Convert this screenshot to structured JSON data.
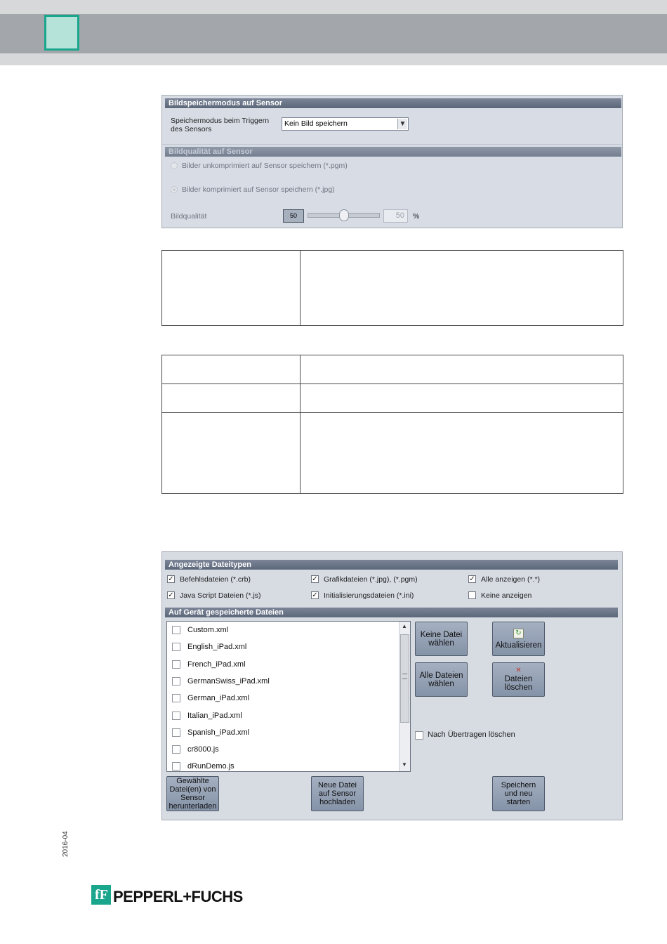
{
  "header": {
    "accent_color": "#1aa68c"
  },
  "image_storage_panel": {
    "title": "Bildspeichermodus auf Sensor",
    "mode_label": "Speichermodus beim Triggern des Sensors",
    "mode_value": "Kein Bild speichern",
    "quality_section_title": "Bildqualität auf Sensor",
    "option_uncompressed": "Bilder unkomprimiert auf Sensor speichern (*.pgm)",
    "option_compressed": "Bilder komprimiert auf Sensor speichern (*.jpg)",
    "quality_label": "Bildqualität",
    "quality_value": "50",
    "quality_slider_value": 50,
    "quality_max_value": "50",
    "quality_unit": "%"
  },
  "file_panel": {
    "file_types_title": "Angezeigte Dateitypen",
    "file_types": [
      {
        "label": "Befehlsdateien (*.crb)",
        "checked": true
      },
      {
        "label": "Grafikdateien (*.jpg), (*.pgm)",
        "checked": true
      },
      {
        "label": "Alle anzeigen (*.*)",
        "checked": true
      },
      {
        "label": "Java Script Dateien (*.js)",
        "checked": true
      },
      {
        "label": "Initialisierungsdateien (*.ini)",
        "checked": true
      },
      {
        "label": "Keine anzeigen",
        "checked": false
      }
    ],
    "stored_files_title": "Auf Gerät gespeicherte Dateien",
    "files": [
      "Custom.xml",
      "English_iPad.xml",
      "French_iPad.xml",
      "GermanSwiss_iPad.xml",
      "German_iPad.xml",
      "Italian_iPad.xml",
      "Spanish_iPad.xml",
      "cr8000.js",
      "dRunDemo.js"
    ],
    "buttons": {
      "select_none": "Keine Datei wählen",
      "refresh": "Aktualisieren",
      "select_all": "Alle Dateien wählen",
      "delete": "Dateien löschen",
      "download": "Gewählte Datei(en) von Sensor herunterladen",
      "upload": "Neue Datei auf Sensor hochladen",
      "save_restart": "Speichern und neu starten"
    },
    "delete_after_transfer": "Nach Übertragen löschen"
  },
  "footer": {
    "date": "2016-04",
    "brand": "PEPPERL+FUCHS",
    "brand_color": "#1aa68c"
  }
}
